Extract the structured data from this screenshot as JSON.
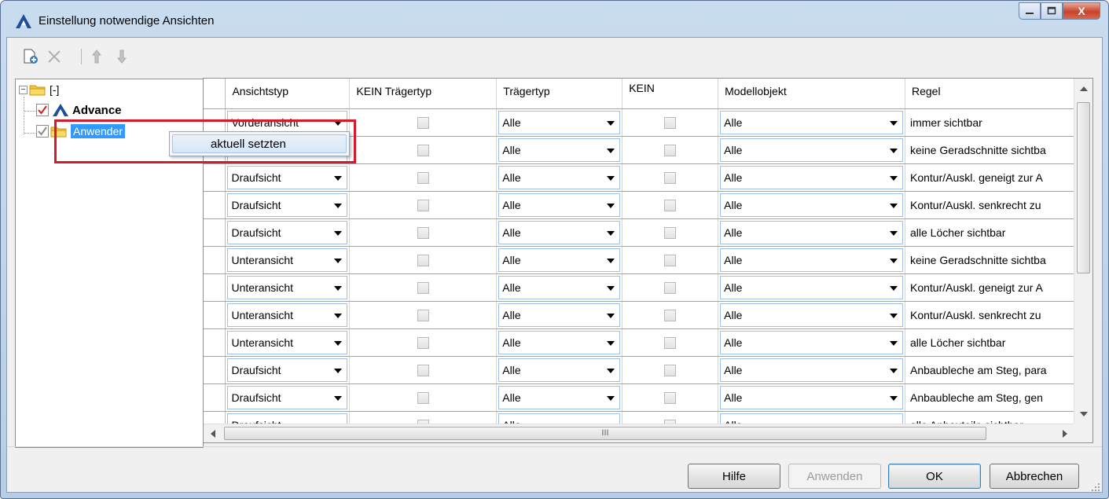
{
  "window": {
    "title": "Einstellung notwendige Ansichten",
    "close_glyph": "X"
  },
  "toolbar": {
    "icons": [
      "new-item-icon",
      "delete-icon",
      "move-up-icon",
      "move-down-icon"
    ]
  },
  "tree": {
    "root_label": "[-]",
    "children": [
      {
        "label": "Advance",
        "checked": true,
        "bold": true,
        "icon": "advance-logo-icon"
      },
      {
        "label": "Anwender",
        "checked": true,
        "selected": true,
        "icon": "folder-icon"
      }
    ]
  },
  "context_menu": {
    "item": "aktuell setzten"
  },
  "grid": {
    "columns": [
      "Ansichtstyp",
      "KEIN Trägertyp",
      "Trägertyp",
      "KEIN",
      "Modellobjekt",
      "Regel"
    ],
    "rows": [
      {
        "ansichtstyp": "Vorderansicht",
        "kein_traegertyp": false,
        "traegertyp": "Alle",
        "kein": false,
        "modellobjekt": "Alle",
        "regel": "immer sichtbar"
      },
      {
        "ansichtstyp": "",
        "kein_traegertyp": false,
        "traegertyp": "Alle",
        "kein": false,
        "modellobjekt": "Alle",
        "regel": "keine Geradschnitte sichtba"
      },
      {
        "ansichtstyp": "Draufsicht",
        "kein_traegertyp": false,
        "traegertyp": "Alle",
        "kein": false,
        "modellobjekt": "Alle",
        "regel": "Kontur/Auskl. geneigt zur A"
      },
      {
        "ansichtstyp": "Draufsicht",
        "kein_traegertyp": false,
        "traegertyp": "Alle",
        "kein": false,
        "modellobjekt": "Alle",
        "regel": "Kontur/Auskl. senkrecht zu"
      },
      {
        "ansichtstyp": "Draufsicht",
        "kein_traegertyp": false,
        "traegertyp": "Alle",
        "kein": false,
        "modellobjekt": "Alle",
        "regel": "alle Löcher sichtbar"
      },
      {
        "ansichtstyp": "Unteransicht",
        "kein_traegertyp": false,
        "traegertyp": "Alle",
        "kein": false,
        "modellobjekt": "Alle",
        "regel": "keine Geradschnitte sichtba"
      },
      {
        "ansichtstyp": "Unteransicht",
        "kein_traegertyp": false,
        "traegertyp": "Alle",
        "kein": false,
        "modellobjekt": "Alle",
        "regel": "Kontur/Auskl. geneigt zur A"
      },
      {
        "ansichtstyp": "Unteransicht",
        "kein_traegertyp": false,
        "traegertyp": "Alle",
        "kein": false,
        "modellobjekt": "Alle",
        "regel": "Kontur/Auskl. senkrecht zu"
      },
      {
        "ansichtstyp": "Unteransicht",
        "kein_traegertyp": false,
        "traegertyp": "Alle",
        "kein": false,
        "modellobjekt": "Alle",
        "regel": "alle Löcher sichtbar"
      },
      {
        "ansichtstyp": "Draufsicht",
        "kein_traegertyp": false,
        "traegertyp": "Alle",
        "kein": false,
        "modellobjekt": "Alle",
        "regel": "Anbaubleche am Steg, para"
      },
      {
        "ansichtstyp": "Draufsicht",
        "kein_traegertyp": false,
        "traegertyp": "Alle",
        "kein": false,
        "modellobjekt": "Alle",
        "regel": "Anbaubleche am Steg, gen"
      },
      {
        "ansichtstyp": "Draufsicht",
        "kein_traegertyp": false,
        "traegertyp": "Alle",
        "kein": false,
        "modellobjekt": "Alle",
        "regel": "alle Anbauteile sichtbar"
      }
    ],
    "hscroll_grip": "III"
  },
  "buttons": {
    "help": "Hilfe",
    "apply": "Anwenden",
    "ok": "OK",
    "cancel": "Abbrechen"
  },
  "colors": {
    "selection": "#3399ff",
    "highlight_box": "#d41b2c",
    "check_red": "#d02020"
  }
}
